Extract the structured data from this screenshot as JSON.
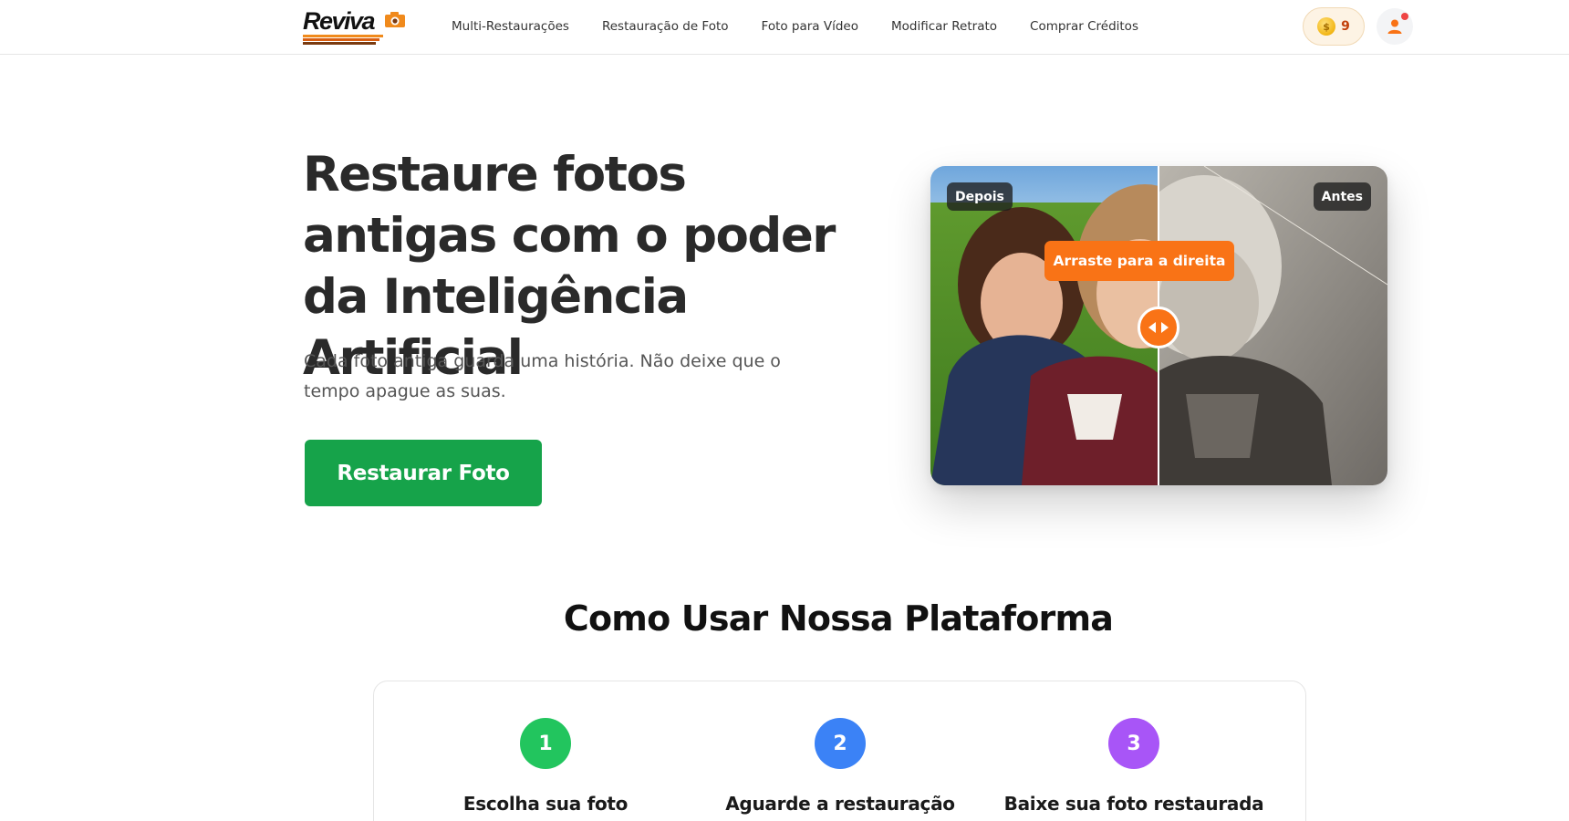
{
  "header": {
    "logo_text": "Reviva",
    "nav": [
      {
        "label": "Multi-Restaurações"
      },
      {
        "label": "Restauração de Foto"
      },
      {
        "label": "Foto para Vídeo"
      },
      {
        "label": "Modificar Retrato"
      },
      {
        "label": "Comprar Créditos"
      }
    ],
    "credits": {
      "count": "9",
      "icon": "coin-icon"
    },
    "user": {
      "icon": "user-icon",
      "has_notification": true
    }
  },
  "hero": {
    "title": "Restaure fotos antigas com o poder da Inteligência Artificial",
    "subtitle": "Cada foto antiga guarda uma história. Não deixe que o tempo apague as suas.",
    "cta_label": "Restaurar Foto"
  },
  "compare": {
    "left_label": "Depois",
    "right_label": "Antes",
    "tooltip": "Arraste para a direita",
    "handle_icon": "drag-arrows-icon"
  },
  "how_to": {
    "title": "Como Usar Nossa Plataforma",
    "steps": [
      {
        "number": "1",
        "title": "Escolha sua foto",
        "color": "#22c55e"
      },
      {
        "number": "2",
        "title": "Aguarde a restauração",
        "color": "#3b82f6"
      },
      {
        "number": "3",
        "title": "Baixe sua foto restaurada",
        "color": "#a855f7"
      }
    ]
  },
  "colors": {
    "accent_orange": "#f97316",
    "cta_green": "#16a34a"
  }
}
